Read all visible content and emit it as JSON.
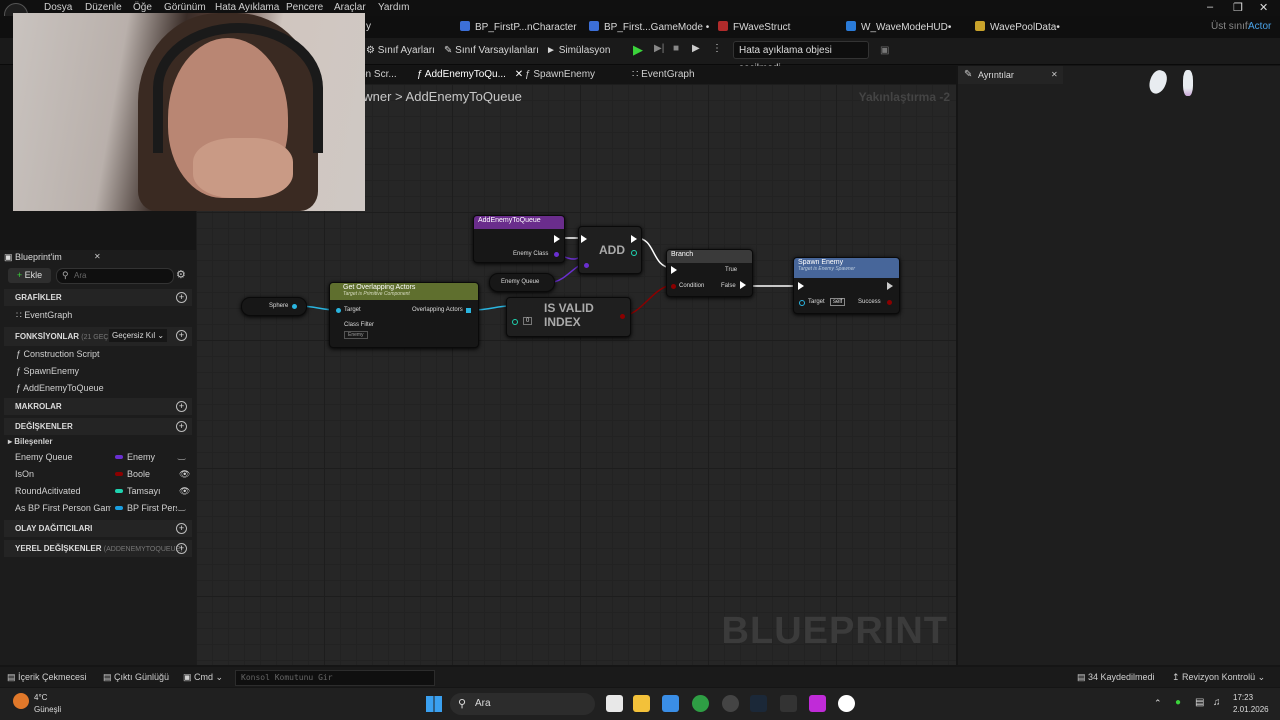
{
  "menubar": {
    "items": [
      "Dosya",
      "Düzenle",
      "Öğe",
      "Görünüm",
      "Hata Ayıklama",
      "Pencere",
      "Araçlar",
      "Yardım"
    ]
  },
  "asset_tabs": [
    {
      "label": "y"
    },
    {
      "label": "BP_FirstP...nCharacter"
    },
    {
      "label": "BP_First...GameMode •"
    },
    {
      "label": "FWaveStruct"
    },
    {
      "label": "W_WaveModeHUD•"
    },
    {
      "label": "WavePoolData•"
    }
  ],
  "parent_class": {
    "label": "Üst sınıf:",
    "value": "Actor"
  },
  "toolbar": {
    "class_settings": "Sınıf Ayarları",
    "class_defaults": "Sınıf Varsayılanları",
    "simulation": "Simülasyon",
    "debug_object": "Hata ayıklama objesi seçilmedi"
  },
  "graph_tabs": [
    {
      "label": "on Scr..."
    },
    {
      "label": "AddEnemyToQu..."
    },
    {
      "label": "SpawnEnemy"
    },
    {
      "label": "EventGraph"
    }
  ],
  "details_tab": "Ayrıntılar",
  "breadcrumb": {
    "parent": "awner",
    "separator": ">",
    "current": "AddEnemyToQueue"
  },
  "zoom": "Yakınlaştırma -2",
  "watermark": "BLUEPRINT",
  "nodes": {
    "add_enemy": {
      "title": "AddEnemyToQueue",
      "pin": "Enemy Class"
    },
    "add": {
      "label": "ADD"
    },
    "branch": {
      "title": "Branch",
      "true": "True",
      "condition": "Condition",
      "false": "False"
    },
    "spawn": {
      "title": "Spawn Enemy",
      "subtitle": "Target is Enemy Spawner",
      "target": "Target",
      "self": "self",
      "success": "Success"
    },
    "sphere": {
      "label": "Sphere"
    },
    "overlap": {
      "title": "Get Overlapping Actors",
      "subtitle": "Target is Primitive Component",
      "target": "Target",
      "class_filter": "Class Filter",
      "filter_value": "Enemy",
      "overlapping": "Overlapping Actors"
    },
    "enemy_queue": {
      "label": "Enemy Queue"
    },
    "is_valid": {
      "line1": "IS VALID",
      "line2": "INDEX",
      "index": "0"
    }
  },
  "my_blueprint": {
    "title": "Blueprint'im",
    "add_button": "Ekle",
    "search_placeholder": "Ara",
    "sections": {
      "graphs": "GRAFİKLER",
      "functions": "FONKSİYONLAR",
      "functions_count": "(21 GEÇERSİ",
      "invalid_label": "Geçersiz Kıl",
      "macros": "MAKROLAR",
      "variables": "DEĞİŞKENLER",
      "components": "Bileşenler",
      "dispatchers": "OLAY DAĞITICILARI",
      "locals": "YEREL DEĞİŞKENLER",
      "locals_suffix": "(ADDENEMYTOQUEUE)"
    },
    "graphs": [
      "EventGraph"
    ],
    "functions": [
      "Construction Script",
      "SpawnEnemy",
      "AddEnemyToQueue"
    ],
    "variables": [
      {
        "name": "Enemy Queue",
        "type": "Enemy",
        "color": "#6a2fd0"
      },
      {
        "name": "IsOn",
        "type": "Boole",
        "color": "#8b0000"
      },
      {
        "name": "RoundAcitivated",
        "type": "Tamsayı",
        "color": "#1fd3b0"
      },
      {
        "name": "As BP First Person Game",
        "type": "BP First Pers",
        "color": "#1a9fe0"
      }
    ]
  },
  "statusbar": {
    "content_drawer": "İçerik Çekmecesi",
    "output_log": "Çıktı Günlüğü",
    "cmd": "Cmd",
    "console_placeholder": "Konsol Komutunu Gir",
    "unsaved": "34 Kaydedilmedi",
    "revision": "Revizyon Kontrolü"
  },
  "taskbar": {
    "temp": "4°C",
    "weather": "Güneşli",
    "search": "Ara",
    "time": "17:23",
    "date": "2.01.2026"
  },
  "colors": {
    "accent": "#1a9fe0",
    "exec": "#ffffff",
    "function_head": "#47669a",
    "pure_head": "#5f6f2e"
  }
}
